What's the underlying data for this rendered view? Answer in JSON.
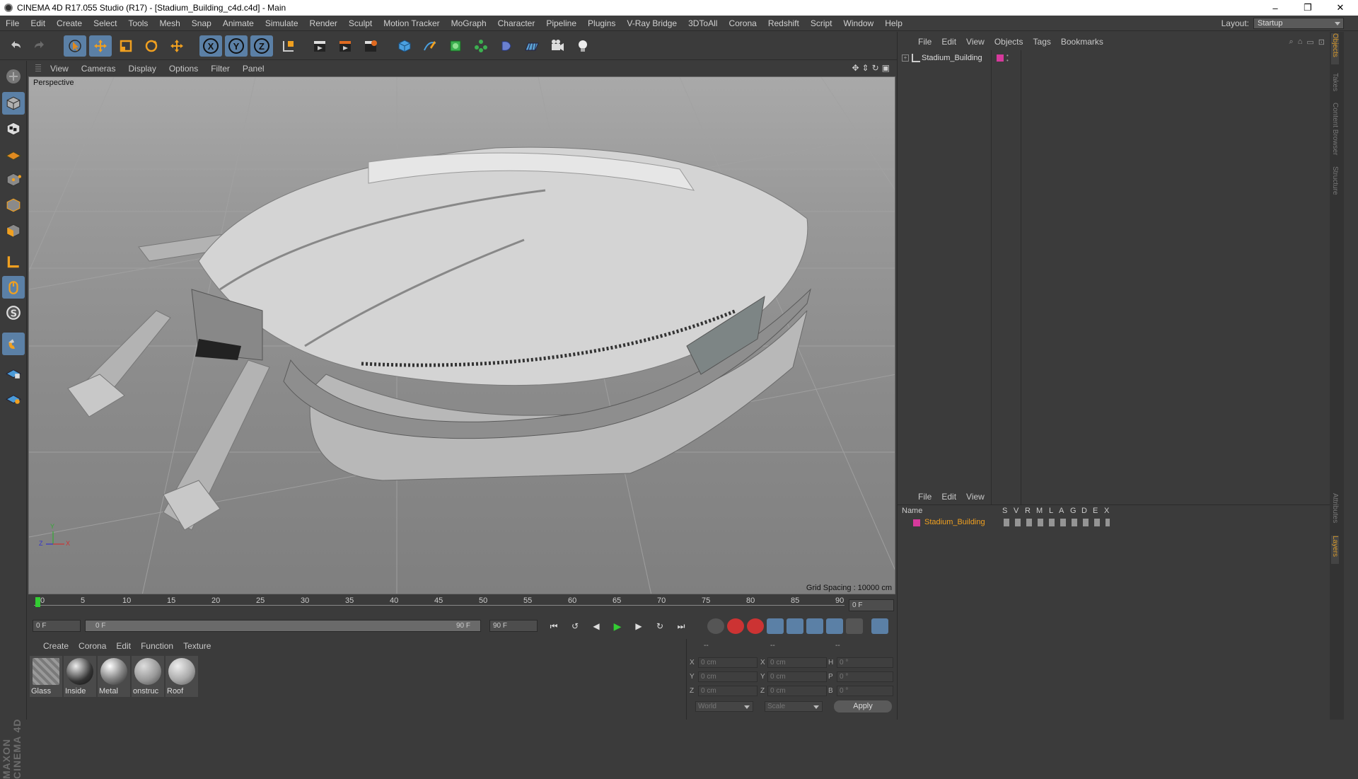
{
  "window": {
    "title": "CINEMA 4D R17.055 Studio (R17) - [Stadium_Building_c4d.c4d] - Main",
    "minimize": "–",
    "restore": "❐",
    "close": "✕"
  },
  "menu": [
    "File",
    "Edit",
    "Create",
    "Select",
    "Tools",
    "Mesh",
    "Snap",
    "Animate",
    "Simulate",
    "Render",
    "Sculpt",
    "Motion Tracker",
    "MoGraph",
    "Character",
    "Pipeline",
    "Plugins",
    "V-Ray Bridge",
    "3DToAll",
    "Corona",
    "Redshift",
    "Script",
    "Window",
    "Help"
  ],
  "layout": {
    "label": "Layout:",
    "value": "Startup"
  },
  "toolbar": {
    "axis_x": "X",
    "axis_y": "Y",
    "axis_z": "Z"
  },
  "viewport": {
    "menu": [
      "View",
      "Cameras",
      "Display",
      "Options",
      "Filter",
      "Panel"
    ],
    "camera_label": "Perspective",
    "grid_spacing": "Grid Spacing : 10000 cm",
    "axis_y": "Y",
    "axis_z": "Z",
    "axis_x": "X"
  },
  "timeline": {
    "ticks": [
      "0",
      "5",
      "10",
      "15",
      "20",
      "25",
      "30",
      "35",
      "40",
      "45",
      "50",
      "55",
      "60",
      "65",
      "70",
      "75",
      "80",
      "85",
      "90"
    ],
    "current_frame": "0 F",
    "start": "0 F",
    "range_start": "0 F",
    "range_end": "90 F",
    "end": "90 F"
  },
  "materials": {
    "menu": [
      "Create",
      "Corona",
      "Edit",
      "Function",
      "Texture"
    ],
    "items": [
      {
        "name": "Glass"
      },
      {
        "name": "Inside"
      },
      {
        "name": "Metal"
      },
      {
        "name": "onstruc"
      },
      {
        "name": "Roof"
      }
    ]
  },
  "coordinates": {
    "headers": [
      "--",
      "--",
      "--"
    ],
    "rows": [
      {
        "l1": "X",
        "v1": "0 cm",
        "l2": "X",
        "v2": "0 cm",
        "l3": "H",
        "v3": "0 °"
      },
      {
        "l1": "Y",
        "v1": "0 cm",
        "l2": "Y",
        "v2": "0 cm",
        "l3": "P",
        "v3": "0 °"
      },
      {
        "l1": "Z",
        "v1": "0 cm",
        "l2": "Z",
        "v2": "0 cm",
        "l3": "B",
        "v3": "0 °"
      }
    ],
    "mode1": "World",
    "mode2": "Scale",
    "apply": "Apply"
  },
  "objects_panel": {
    "menu": [
      "File",
      "Edit",
      "View",
      "Objects",
      "Tags",
      "Bookmarks"
    ],
    "object_name": "Stadium_Building",
    "object_color": "#d63a9c"
  },
  "layers_panel": {
    "menu": [
      "File",
      "Edit",
      "View"
    ],
    "columns": [
      "Name",
      "S",
      "V",
      "R",
      "M",
      "L",
      "A",
      "G",
      "D",
      "E",
      "X"
    ],
    "row_name": "Stadium_Building"
  },
  "side_tabs": [
    "Objects",
    "Takes",
    "Content Browser",
    "Structure"
  ],
  "side_tabs_lower": [
    "Attributes",
    "Layers"
  ],
  "branding": "MAXON CINEMA 4D"
}
